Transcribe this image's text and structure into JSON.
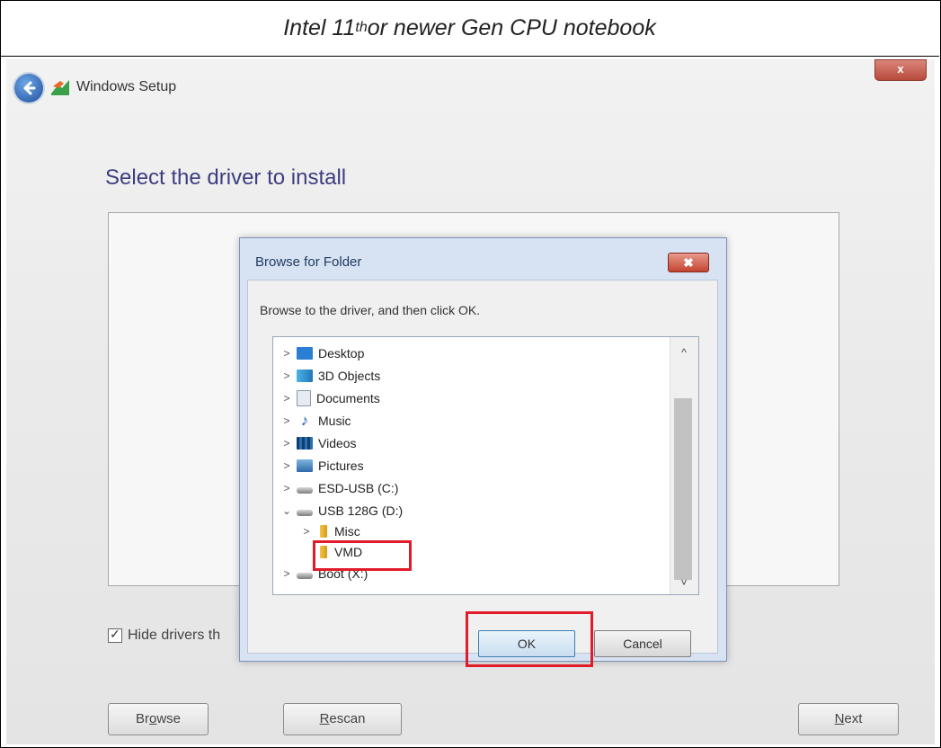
{
  "caption": {
    "prefix": "Intel 11",
    "sup": "th",
    "suffix": " or newer Gen CPU notebook"
  },
  "setup": {
    "window_title": "Windows Setup",
    "close_label": "x",
    "heading": "Select the driver to install",
    "hide_checkbox_label": "Hide drivers th",
    "hide_checked": true,
    "browse": {
      "pre": "Br",
      "accel": "o",
      "post": "wse"
    },
    "rescan": {
      "pre": "",
      "accel": "R",
      "post": "escan"
    },
    "next": {
      "pre": "",
      "accel": "N",
      "post": "ext"
    }
  },
  "dialog": {
    "title": "Browse for Folder",
    "close_label": "✖",
    "instruction": "Browse to the driver, and then click OK.",
    "items": [
      {
        "label": "Desktop",
        "arrow": ">",
        "icon": "desktop-icon"
      },
      {
        "label": "3D Objects",
        "arrow": ">",
        "icon": "3d-objects-icon"
      },
      {
        "label": "Documents",
        "arrow": ">",
        "icon": "documents-icon"
      },
      {
        "label": "Music",
        "arrow": ">",
        "icon": "music-icon"
      },
      {
        "label": "Videos",
        "arrow": ">",
        "icon": "videos-icon"
      },
      {
        "label": "Pictures",
        "arrow": ">",
        "icon": "pictures-icon"
      },
      {
        "label": "ESD-USB (C:)",
        "arrow": ">",
        "icon": "drive-icon"
      },
      {
        "label": "USB 128G (D:)",
        "arrow": "⌄",
        "icon": "drive-icon"
      },
      {
        "label": "Misc",
        "arrow": ">",
        "icon": "folder-icon"
      },
      {
        "label": "VMD",
        "arrow": "",
        "icon": "folder-icon"
      },
      {
        "label": "Boot (X:)",
        "arrow": ">",
        "icon": "drive-icon"
      }
    ],
    "scroll_up": "^",
    "scroll_down": "˅",
    "ok_label": "OK",
    "cancel_label": "Cancel"
  },
  "colors": {
    "highlight": "#e21b2a",
    "heading": "#3d3d80"
  }
}
